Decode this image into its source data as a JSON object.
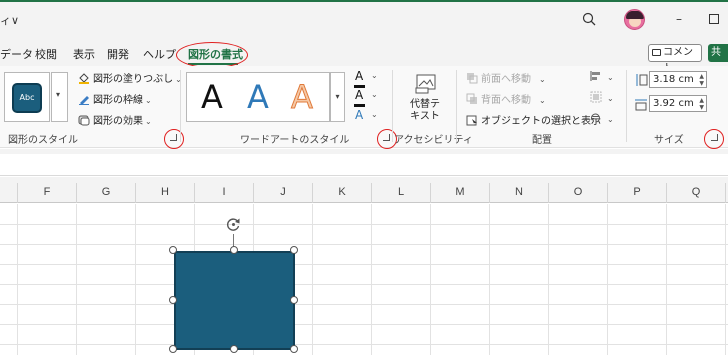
{
  "titlebar": {
    "title_fragment": "ィ∨",
    "icons": [
      "search-icon",
      "account-avatar",
      "minimize-icon",
      "maximize-icon"
    ]
  },
  "tabs": [
    {
      "label": "データ",
      "active": false
    },
    {
      "label": "校閲",
      "active": false
    },
    {
      "label": "表示",
      "active": false
    },
    {
      "label": "開発",
      "active": false
    },
    {
      "label": "ヘルプ",
      "active": false
    },
    {
      "label": "図形の書式",
      "active": true
    }
  ],
  "actions": {
    "comment_label": "コメント",
    "share_label": "共"
  },
  "ribbon": {
    "shape_styles": {
      "sample_label": "Abc",
      "fill_label": "図形の塗りつぶし",
      "outline_label": "図形の枠線",
      "effects_label": "図形の効果",
      "group_label": "図形のスタイル"
    },
    "wordart": {
      "sample_letters": [
        "A",
        "A",
        "A"
      ],
      "text_fill_label": "A",
      "text_outline_label": "A",
      "text_effects_label": "A",
      "group_label": "ワードアートのスタイル"
    },
    "accessibility": {
      "alt_text_label": "代替テキスト",
      "group_label": "アクセシビリティ"
    },
    "arrange": {
      "bring_forward_label": "前面へ移動",
      "send_backward_label": "背面へ移動",
      "selection_pane_label": "オブジェクトの選択と表示",
      "group_label": "配置"
    },
    "size": {
      "height_value": "3.18 cm",
      "width_value": "3.92 cm",
      "group_label": "サイズ"
    }
  },
  "sheet": {
    "columns": [
      "F",
      "G",
      "H",
      "I",
      "J",
      "K",
      "L",
      "M",
      "N",
      "O",
      "P",
      "Q"
    ]
  },
  "colors": {
    "accent": "#217346",
    "shape_fill": "#1b5e7d",
    "highlight_red": "#e02020"
  }
}
